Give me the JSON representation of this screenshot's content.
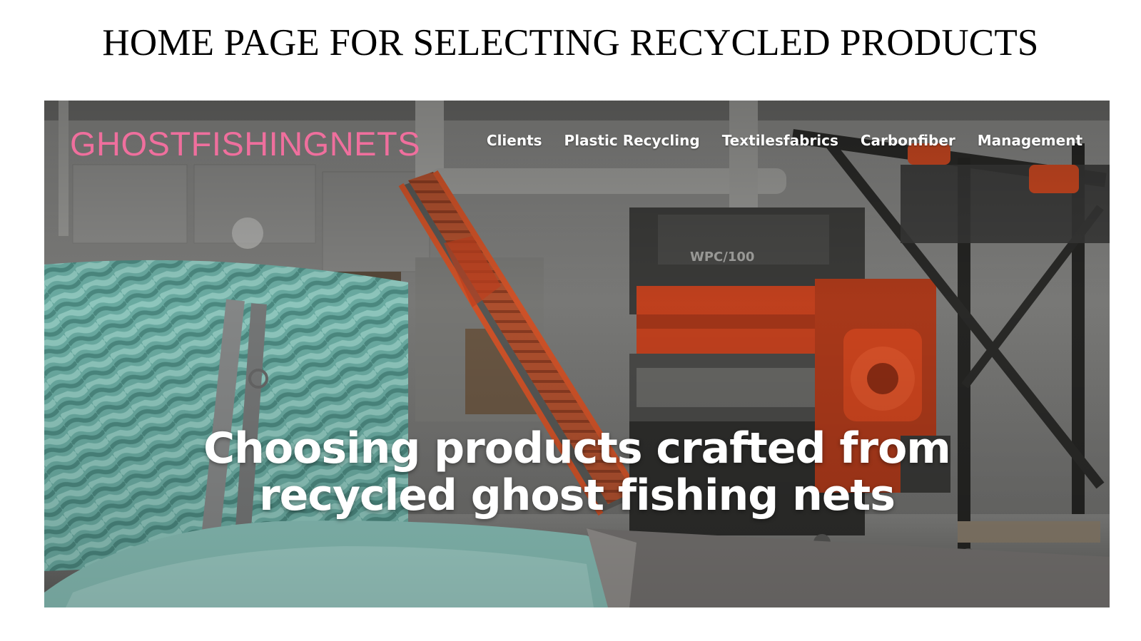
{
  "page": {
    "title": "HOME PAGE FOR SELECTING RECYCLED PRODUCTS"
  },
  "site": {
    "logo": "GHOSTFISHINGNETS",
    "nav": [
      {
        "label": "Clients"
      },
      {
        "label": "Plastic Recycling"
      },
      {
        "label": "Textilesfabrics"
      },
      {
        "label": "Carbonfiber"
      },
      {
        "label": "Management"
      }
    ]
  },
  "hero": {
    "headline_line1": "Choosing products crafted from",
    "headline_line2": "recycled ghost fishing nets",
    "machine_label": "WPC/100"
  },
  "colors": {
    "logo": "#ef6f9d",
    "machine_orange": "#c9431f",
    "rope_teal": "#74b8ae"
  },
  "icons": {
    "scene": "recycling-facility-photo"
  }
}
